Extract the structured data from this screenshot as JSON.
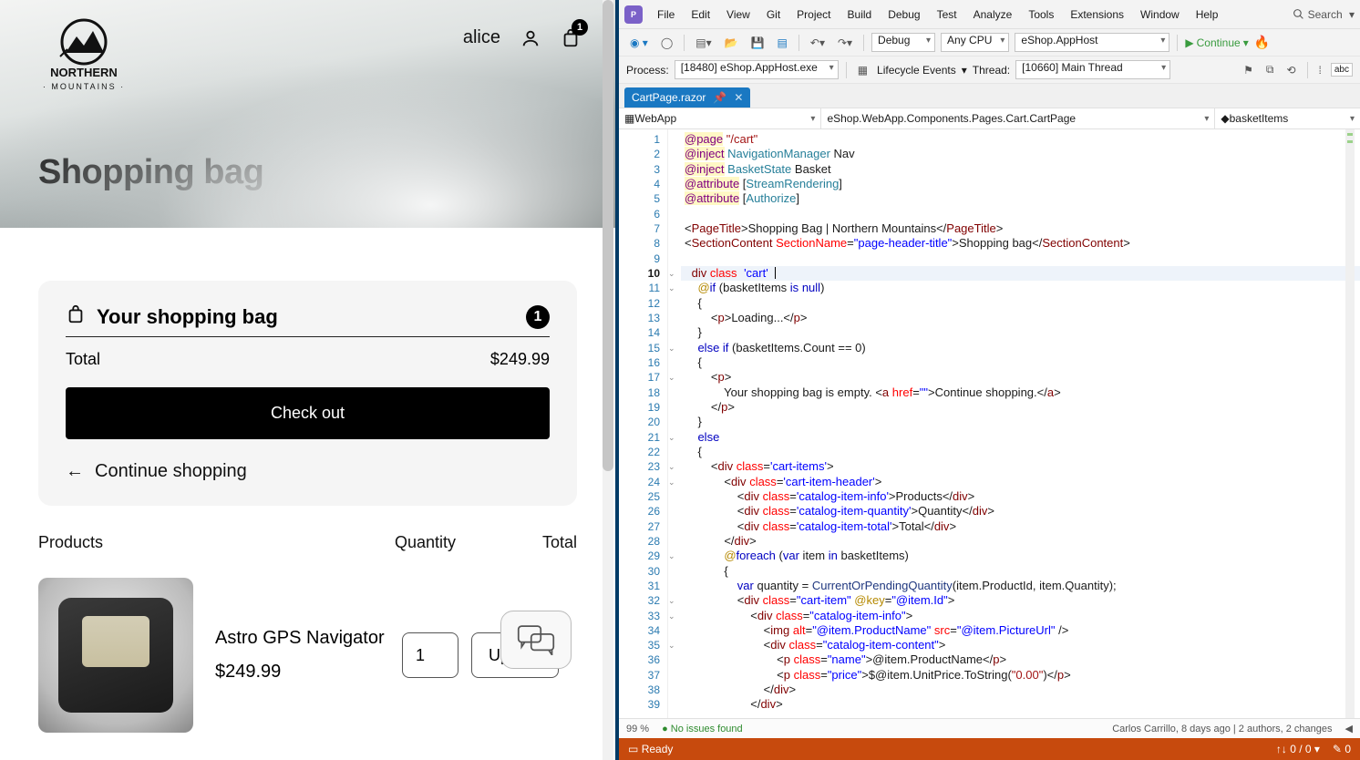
{
  "web": {
    "username": "alice",
    "cart_mini_count": "1",
    "hero_title": "Shopping bag",
    "panel_title": "Your shopping bag",
    "panel_badge": "1",
    "total_label": "Total",
    "total_value": "$249.99",
    "checkout_label": "Check out",
    "continue_label": "Continue shopping",
    "cols": {
      "products": "Products",
      "quantity": "Quantity",
      "total": "Total"
    },
    "items": [
      {
        "name": "Astro GPS Navigator",
        "price": "$249.99",
        "qty": "1",
        "update": "Update"
      }
    ]
  },
  "vs": {
    "menu": [
      "File",
      "Edit",
      "View",
      "Git",
      "Project",
      "Build",
      "Debug",
      "Test",
      "Analyze",
      "Tools",
      "Extensions",
      "Window",
      "Help"
    ],
    "search_label": "Search",
    "config": "Debug",
    "platform": "Any CPU",
    "startup": "eShop.AppHost",
    "continue_label": "Continue",
    "process_label": "Process:",
    "process_value": "[18480] eShop.AppHost.exe",
    "lifecycle_label": "Lifecycle Events",
    "thread_label": "Thread:",
    "thread_value": "[10660] Main Thread",
    "tab_name": "CartPage.razor",
    "nav1": "WebApp",
    "nav2": "eShop.WebApp.Components.Pages.Cart.CartPage",
    "nav3": "basketItems",
    "zoom": "99 %",
    "issues": "No issues found",
    "blame": "Carlos Carrillo, 8 days ago | 2 authors, 2 changes",
    "status_ready": "Ready",
    "status_nav": "0 / 0",
    "status_err": "0",
    "lines": [
      {
        "n": 1,
        "html": "<span class='hilite'><span class='razorkw'>@page</span></span> <span class='str'>\"/cart\"</span>"
      },
      {
        "n": 2,
        "html": "<span class='hilite'><span class='razorkw'>@inject</span></span> <span class='type'>NavigationManager</span> Nav"
      },
      {
        "n": 3,
        "html": "<span class='hilite'><span class='razorkw'>@inject</span></span> <span class='type'>BasketState</span> Basket"
      },
      {
        "n": 4,
        "html": "<span class='hilite'><span class='razorkw'>@attribute</span></span> [<span class='type'>StreamRendering</span>]"
      },
      {
        "n": 5,
        "html": "<span class='hilite'><span class='razorkw'>@attribute</span></span> [<span class='type'>Authorize</span>]"
      },
      {
        "n": 6,
        "html": ""
      },
      {
        "n": 7,
        "html": "&lt;<span class='tag'>PageTitle</span>&gt;Shopping Bag | Northern Mountains&lt;/<span class='tag'>PageTitle</span>&gt;"
      },
      {
        "n": 8,
        "html": "&lt;<span class='tag'>SectionContent</span> <span class='attr'>SectionName</span>=<span class='attrval'>\"page-header-title\"</span>&gt;Shopping bag&lt;/<span class='tag'>SectionContent</span>&gt;"
      },
      {
        "n": 9,
        "html": ""
      },
      {
        "n": 10,
        "fold": "⌄",
        "current": true,
        "html": "&lt;<span class='tag'>div</span> <span class='attr'>class</span>=<span class='attrval'>'cart'</span>&gt;<span class='text-cursor'></span>"
      },
      {
        "n": 11,
        "fold": "⌄",
        "html": "    <span class='razor'>@</span><span class='kw'>if</span> (basketItems <span class='kw'>is</span> <span class='kw'>null</span>)"
      },
      {
        "n": 12,
        "html": "    {"
      },
      {
        "n": 13,
        "html": "        &lt;<span class='tag'>p</span>&gt;Loading...&lt;/<span class='tag'>p</span>&gt;"
      },
      {
        "n": 14,
        "html": "    }"
      },
      {
        "n": 15,
        "fold": "⌄",
        "html": "    <span class='kw'>else if</span> (basketItems.Count == 0)"
      },
      {
        "n": 16,
        "html": "    {"
      },
      {
        "n": 17,
        "fold": "⌄",
        "html": "        &lt;<span class='tag'>p</span>&gt;"
      },
      {
        "n": 18,
        "html": "            Your shopping bag is empty. &lt;<span class='tag'>a</span> <span class='attr'>href</span>=<span class='attrval'>\"\"</span>&gt;Continue shopping.&lt;/<span class='tag'>a</span>&gt;"
      },
      {
        "n": 19,
        "html": "        &lt;/<span class='tag'>p</span>&gt;"
      },
      {
        "n": 20,
        "html": "    }"
      },
      {
        "n": 21,
        "fold": "⌄",
        "html": "    <span class='kw'>else</span>"
      },
      {
        "n": 22,
        "html": "    {"
      },
      {
        "n": 23,
        "fold": "⌄",
        "html": "        &lt;<span class='tag'>div</span> <span class='attr'>class</span>=<span class='attrval'>'cart-items'</span>&gt;"
      },
      {
        "n": 24,
        "fold": "⌄",
        "html": "            &lt;<span class='tag'>div</span> <span class='attr'>class</span>=<span class='attrval'>'cart-item-header'</span>&gt;"
      },
      {
        "n": 25,
        "html": "                &lt;<span class='tag'>div</span> <span class='attr'>class</span>=<span class='attrval'>'catalog-item-info'</span>&gt;Products&lt;/<span class='tag'>div</span>&gt;"
      },
      {
        "n": 26,
        "html": "                &lt;<span class='tag'>div</span> <span class='attr'>class</span>=<span class='attrval'>'catalog-item-quantity'</span>&gt;Quantity&lt;/<span class='tag'>div</span>&gt;"
      },
      {
        "n": 27,
        "html": "                &lt;<span class='tag'>div</span> <span class='attr'>class</span>=<span class='attrval'>'catalog-item-total'</span>&gt;Total&lt;/<span class='tag'>div</span>&gt;"
      },
      {
        "n": 28,
        "html": "            &lt;/<span class='tag'>div</span>&gt;"
      },
      {
        "n": 29,
        "fold": "⌄",
        "html": "            <span class='razor'>@</span><span class='kw'>foreach</span> (<span class='kw'>var</span> item <span class='kw'>in</span> basketItems)"
      },
      {
        "n": 30,
        "html": "            {"
      },
      {
        "n": 31,
        "html": "                <span class='kw'>var</span> quantity = <span class='ident'>CurrentOrPendingQuantity</span>(item.ProductId, item.Quantity);"
      },
      {
        "n": 32,
        "fold": "⌄",
        "html": "                &lt;<span class='tag'>div</span> <span class='attr'>class</span>=<span class='attrval'>\"cart-item\"</span> <span class='razor'>@key</span>=<span class='attrval'>\"@item.Id\"</span>&gt;"
      },
      {
        "n": 33,
        "fold": "⌄",
        "html": "                    &lt;<span class='tag'>div</span> <span class='attr'>class</span>=<span class='attrval'>\"catalog-item-info\"</span>&gt;"
      },
      {
        "n": 34,
        "html": "                        &lt;<span class='tag'>img</span> <span class='attr'>alt</span>=<span class='attrval'>\"@item.ProductName\"</span> <span class='attr'>src</span>=<span class='attrval'>\"@item.PictureUrl\"</span> /&gt;"
      },
      {
        "n": 35,
        "fold": "⌄",
        "html": "                        &lt;<span class='tag'>div</span> <span class='attr'>class</span>=<span class='attrval'>\"catalog-item-content\"</span>&gt;"
      },
      {
        "n": 36,
        "html": "                            &lt;<span class='tag'>p</span> <span class='attr'>class</span>=<span class='attrval'>\"name\"</span>&gt;@item.ProductName&lt;/<span class='tag'>p</span>&gt;"
      },
      {
        "n": 37,
        "html": "                            &lt;<span class='tag'>p</span> <span class='attr'>class</span>=<span class='attrval'>\"price\"</span>&gt;$@item.UnitPrice.ToString(<span class='str'>\"0.00\"</span>)&lt;/<span class='tag'>p</span>&gt;"
      },
      {
        "n": 38,
        "html": "                        &lt;/<span class='tag'>div</span>&gt;"
      },
      {
        "n": 39,
        "html": "                    &lt;/<span class='tag'>div</span>&gt;"
      }
    ]
  }
}
